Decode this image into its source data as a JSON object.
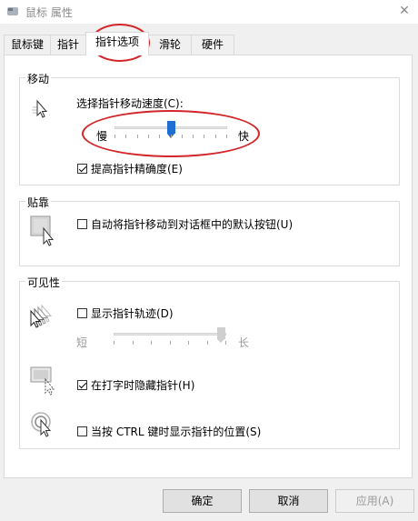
{
  "window": {
    "title": "鼠标 属性",
    "close_symbol": "✕"
  },
  "tabs": [
    {
      "label": "鼠标键"
    },
    {
      "label": "指针"
    },
    {
      "label": "指针选项",
      "active": true
    },
    {
      "label": "滑轮"
    },
    {
      "label": "硬件"
    }
  ],
  "motion": {
    "title": "移动",
    "speed_label": "选择指针移动速度(C):",
    "slow_label": "慢",
    "fast_label": "快",
    "speed_value_fraction": 0.5,
    "precision_label": "提高指针精确度(E)",
    "precision_checked": true
  },
  "snap": {
    "title": "贴靠",
    "snap_label": "自动将指针移动到对话框中的默认按钮(U)",
    "snap_checked": false
  },
  "visibility": {
    "title": "可见性",
    "trails_label": "显示指针轨迹(D)",
    "trails_checked": false,
    "short_label": "短",
    "long_label": "长",
    "trails_value_fraction": 1.0,
    "hide_label": "在打字时隐藏指针(H)",
    "hide_checked": true,
    "show_ctrl_label": "当按 CTRL 键时显示指针的位置(S)",
    "show_ctrl_checked": false
  },
  "buttons": {
    "ok": "确定",
    "cancel": "取消",
    "apply": "应用(A)"
  },
  "colors": {
    "accent": "#1f6ed4",
    "annotation": "#d3262a"
  }
}
